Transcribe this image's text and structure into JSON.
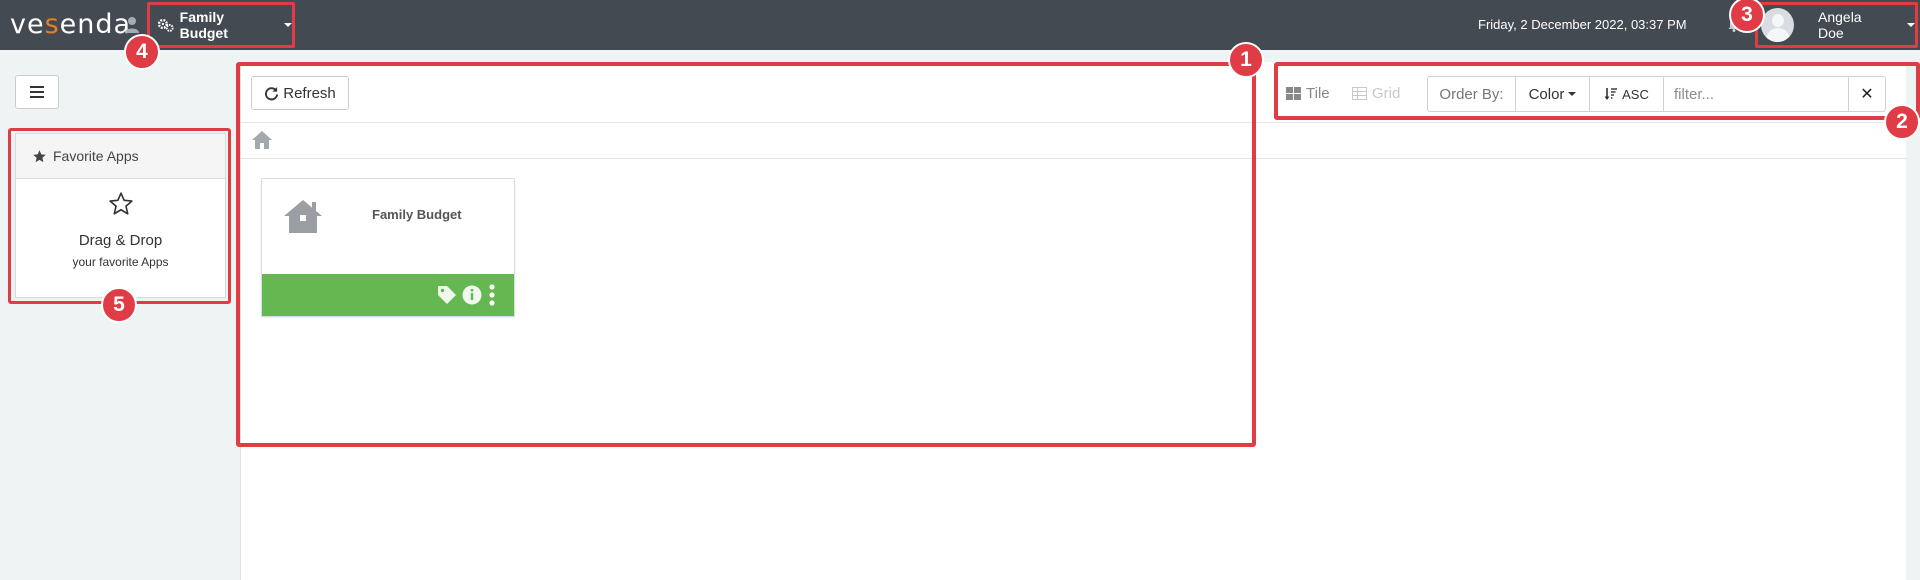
{
  "topbar": {
    "logo": {
      "prefix": "ve",
      "mark": "s",
      "suffix": "enda"
    },
    "app_switcher": {
      "label": "Family Budget",
      "icon": "gears-icon"
    },
    "datetime": "Friday, 2 December 2022, 03:37 PM",
    "notifications_icon": "bell-icon",
    "user": {
      "name": "Angela Doe",
      "avatar": "avatar-icon"
    }
  },
  "sidebar": {
    "toggle_icon": "hamburger-icon",
    "favorites": {
      "title": "Favorite Apps",
      "line1": "Drag & Drop",
      "line2": "your favorite Apps"
    }
  },
  "toolbar": {
    "refresh_label": "Refresh",
    "view_tile_label": "Tile",
    "view_grid_label": "Grid",
    "order_by_label": "Order By:",
    "order_field": "Color",
    "sort_direction": "ASC",
    "filter_value": "",
    "filter_placeholder": "filter...",
    "clear_icon": "close-icon"
  },
  "breadcrumb": {
    "home_icon": "home-icon"
  },
  "apps": [
    {
      "name": "Family Budget",
      "icon": "house-icon",
      "footer_color": "#64b751"
    }
  ],
  "annotations": [
    "1",
    "2",
    "3",
    "4",
    "5"
  ],
  "colors": {
    "topbar": "#444a52",
    "accent_logo": "#e8801e",
    "annotation": "#e03c45",
    "tile_footer": "#64b751",
    "background": "#eef3f4"
  }
}
